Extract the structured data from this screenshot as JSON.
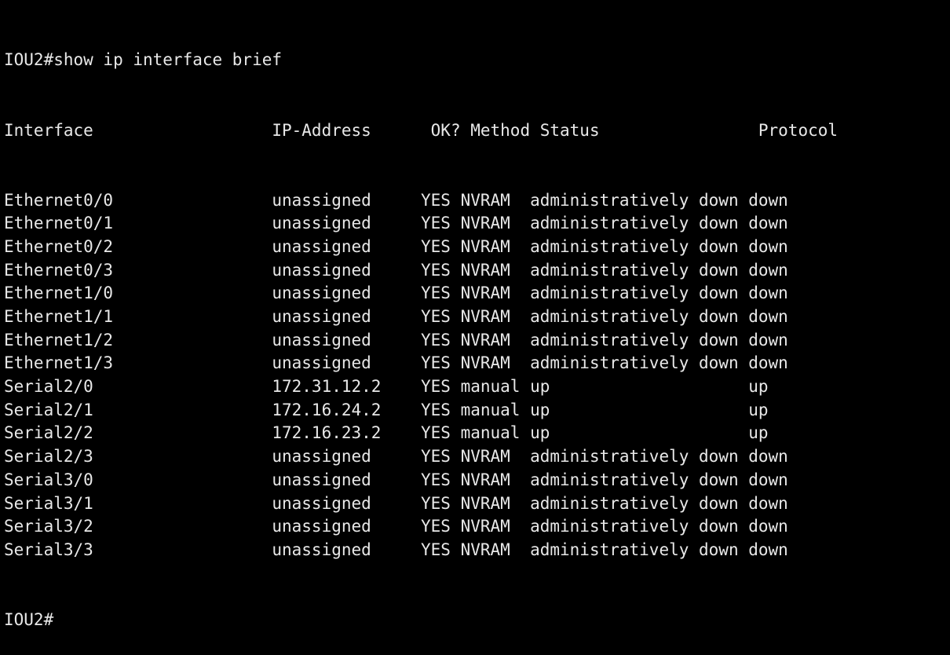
{
  "terminal": {
    "background_color": "#000000",
    "text_color": "#e8e8e8",
    "hostname": "IOU2",
    "prompt_symbol": "#",
    "command_line": "IOU2#show ip interface brief",
    "command": "show ip interface brief",
    "final_prompt": "IOU2#",
    "columns": {
      "interface": "Interface",
      "ip_address": "IP-Address",
      "ok": "OK?",
      "method": "Method",
      "status": "Status",
      "protocol": "Protocol"
    },
    "column_offsets": {
      "interface": 0,
      "ip_address": 27,
      "ok": 42,
      "method": 46,
      "status": 53,
      "protocol": 75
    },
    "header_line": "Interface                  IP-Address      OK? Method Status                Protocol",
    "rows": [
      {
        "interface": "Ethernet0/0",
        "ip_address": "unassigned",
        "ok": "YES",
        "method": "NVRAM",
        "status": "administratively down",
        "protocol": "down"
      },
      {
        "interface": "Ethernet0/1",
        "ip_address": "unassigned",
        "ok": "YES",
        "method": "NVRAM",
        "status": "administratively down",
        "protocol": "down"
      },
      {
        "interface": "Ethernet0/2",
        "ip_address": "unassigned",
        "ok": "YES",
        "method": "NVRAM",
        "status": "administratively down",
        "protocol": "down"
      },
      {
        "interface": "Ethernet0/3",
        "ip_address": "unassigned",
        "ok": "YES",
        "method": "NVRAM",
        "status": "administratively down",
        "protocol": "down"
      },
      {
        "interface": "Ethernet1/0",
        "ip_address": "unassigned",
        "ok": "YES",
        "method": "NVRAM",
        "status": "administratively down",
        "protocol": "down"
      },
      {
        "interface": "Ethernet1/1",
        "ip_address": "unassigned",
        "ok": "YES",
        "method": "NVRAM",
        "status": "administratively down",
        "protocol": "down"
      },
      {
        "interface": "Ethernet1/2",
        "ip_address": "unassigned",
        "ok": "YES",
        "method": "NVRAM",
        "status": "administratively down",
        "protocol": "down"
      },
      {
        "interface": "Ethernet1/3",
        "ip_address": "unassigned",
        "ok": "YES",
        "method": "NVRAM",
        "status": "administratively down",
        "protocol": "down"
      },
      {
        "interface": "Serial2/0",
        "ip_address": "172.31.12.2",
        "ok": "YES",
        "method": "manual",
        "status": "up",
        "protocol": "up"
      },
      {
        "interface": "Serial2/1",
        "ip_address": "172.16.24.2",
        "ok": "YES",
        "method": "manual",
        "status": "up",
        "protocol": "up"
      },
      {
        "interface": "Serial2/2",
        "ip_address": "172.16.23.2",
        "ok": "YES",
        "method": "manual",
        "status": "up",
        "protocol": "up"
      },
      {
        "interface": "Serial2/3",
        "ip_address": "unassigned",
        "ok": "YES",
        "method": "NVRAM",
        "status": "administratively down",
        "protocol": "down"
      },
      {
        "interface": "Serial3/0",
        "ip_address": "unassigned",
        "ok": "YES",
        "method": "NVRAM",
        "status": "administratively down",
        "protocol": "down"
      },
      {
        "interface": "Serial3/1",
        "ip_address": "unassigned",
        "ok": "YES",
        "method": "NVRAM",
        "status": "administratively down",
        "protocol": "down"
      },
      {
        "interface": "Serial3/2",
        "ip_address": "unassigned",
        "ok": "YES",
        "method": "NVRAM",
        "status": "administratively down",
        "protocol": "down"
      },
      {
        "interface": "Serial3/3",
        "ip_address": "unassigned",
        "ok": "YES",
        "method": "NVRAM",
        "status": "administratively down",
        "protocol": "down"
      }
    ]
  }
}
